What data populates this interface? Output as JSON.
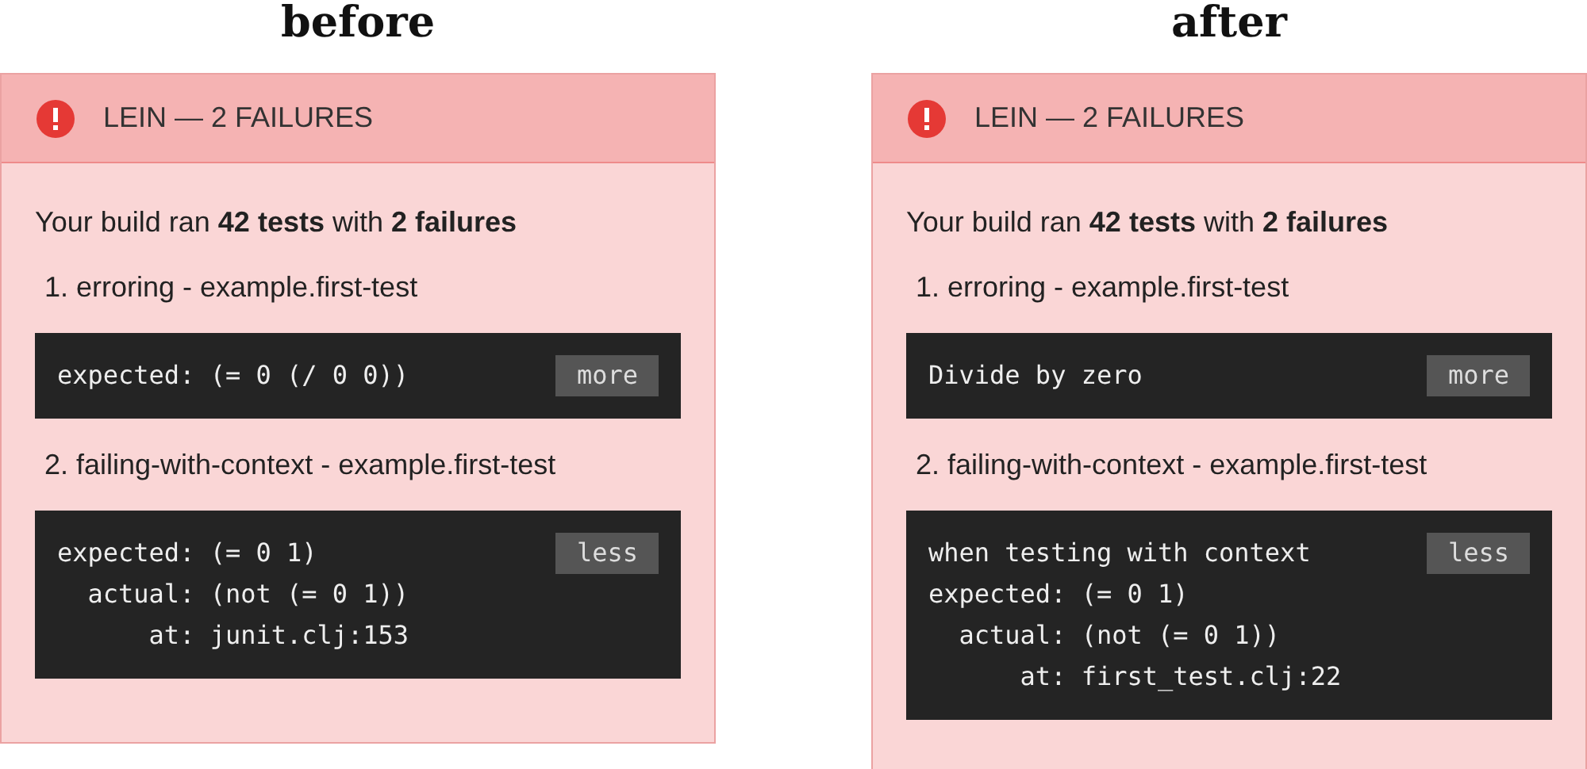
{
  "panels": [
    {
      "caption": "before",
      "header": {
        "title": "LEIN — 2 FAILURES"
      },
      "summary": "Your build ran **42 tests** with **2 failures**",
      "failures": [
        {
          "label": "1. erroring - example.first-test",
          "code": [
            "expected: (= 0 (/ 0 0))"
          ],
          "toggle": "more"
        },
        {
          "label": "2. failing-with-context - example.first-test",
          "code": [
            "expected: (= 0 1)",
            "  actual: (not (= 0 1))",
            "      at: junit.clj:153"
          ],
          "toggle": "less"
        }
      ]
    },
    {
      "caption": "after",
      "header": {
        "title": "LEIN — 2 FAILURES"
      },
      "summary": "Your build ran **42 tests** with **2 failures**",
      "failures": [
        {
          "label": "1. erroring - example.first-test",
          "code": [
            "Divide by zero"
          ],
          "toggle": "more"
        },
        {
          "label": "2. failing-with-context - example.first-test",
          "code": [
            "when testing with context",
            "expected: (= 0 1)",
            "  actual: (not (= 0 1))",
            "      at: first_test.clj:22"
          ],
          "toggle": "less"
        }
      ]
    }
  ]
}
